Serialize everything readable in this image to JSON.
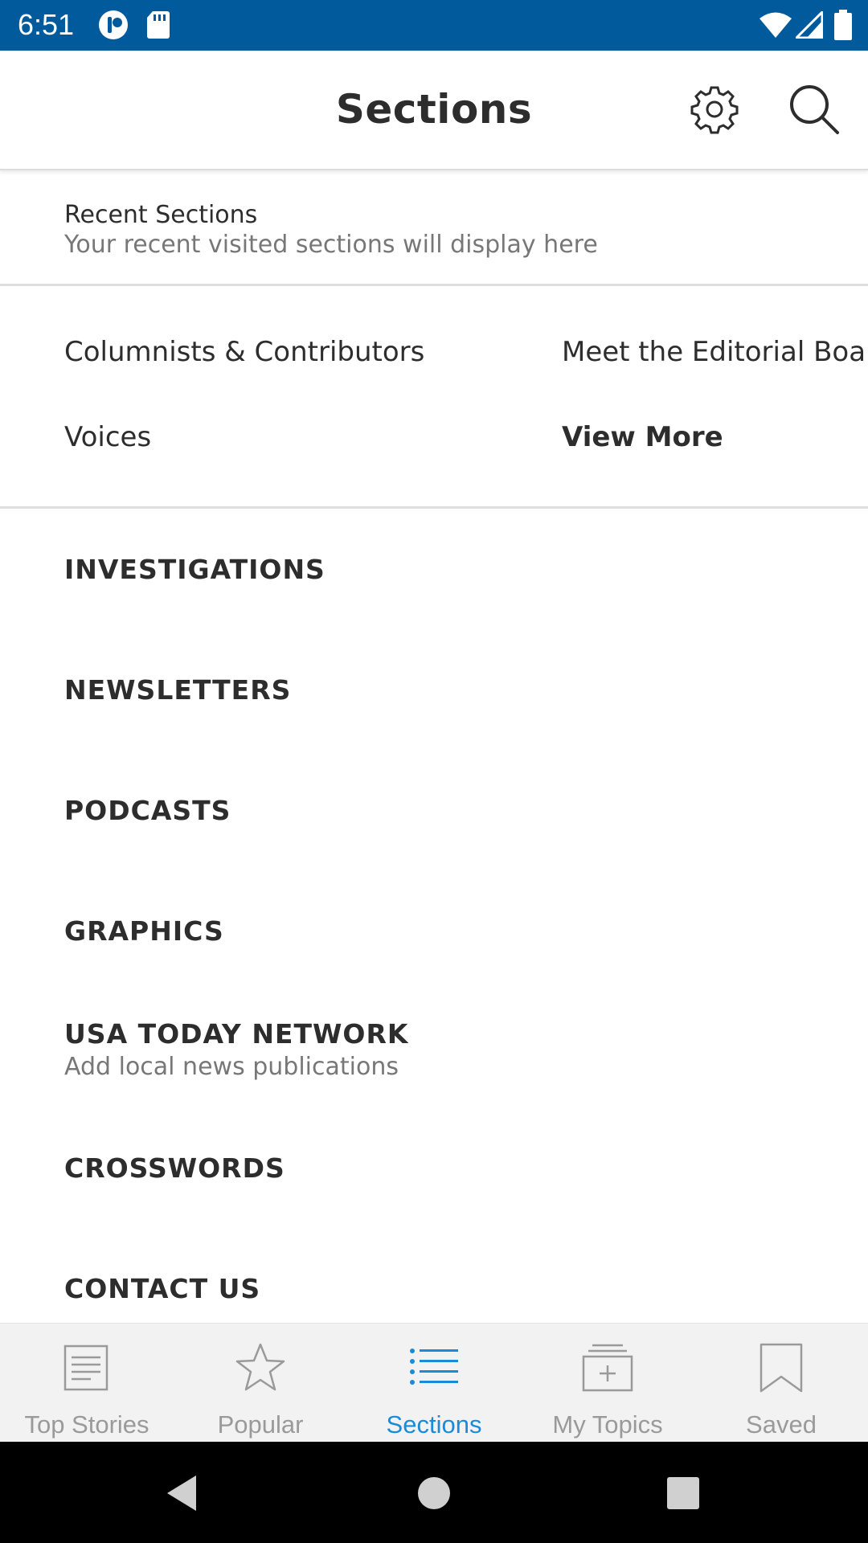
{
  "status_bar": {
    "time": "6:51",
    "bg_color": "#005a9c",
    "icons": [
      "app-notification-icon",
      "sd-card-icon",
      "wifi-icon",
      "signal-icon",
      "battery-icon"
    ]
  },
  "header": {
    "title": "Sections",
    "settings_icon": "gear-icon",
    "search_icon": "search-icon"
  },
  "recent_sections": {
    "title": "Recent Sections",
    "subtitle": "Your recent visited sections will display here"
  },
  "opinion_links": [
    "Columnists & Contributors",
    "Meet the Editorial Board",
    "Voices",
    "View More"
  ],
  "sections": [
    {
      "label": "INVESTIGATIONS"
    },
    {
      "label": "NEWSLETTERS"
    },
    {
      "label": "PODCASTS"
    },
    {
      "label": "GRAPHICS"
    },
    {
      "label": "USA TODAY NETWORK",
      "subtitle": "Add local news publications"
    },
    {
      "label": "CROSSWORDS"
    },
    {
      "label": "CONTACT US"
    }
  ],
  "tabs": [
    {
      "label": "Top Stories",
      "icon": "newspaper-icon"
    },
    {
      "label": "Popular",
      "icon": "star-icon"
    },
    {
      "label": "Sections",
      "icon": "list-icon",
      "active": true
    },
    {
      "label": "My Topics",
      "icon": "topics-add-icon"
    },
    {
      "label": "Saved",
      "icon": "bookmark-icon"
    }
  ],
  "colors": {
    "accent": "#1a8bd8",
    "inactive": "#9a9a9a"
  }
}
